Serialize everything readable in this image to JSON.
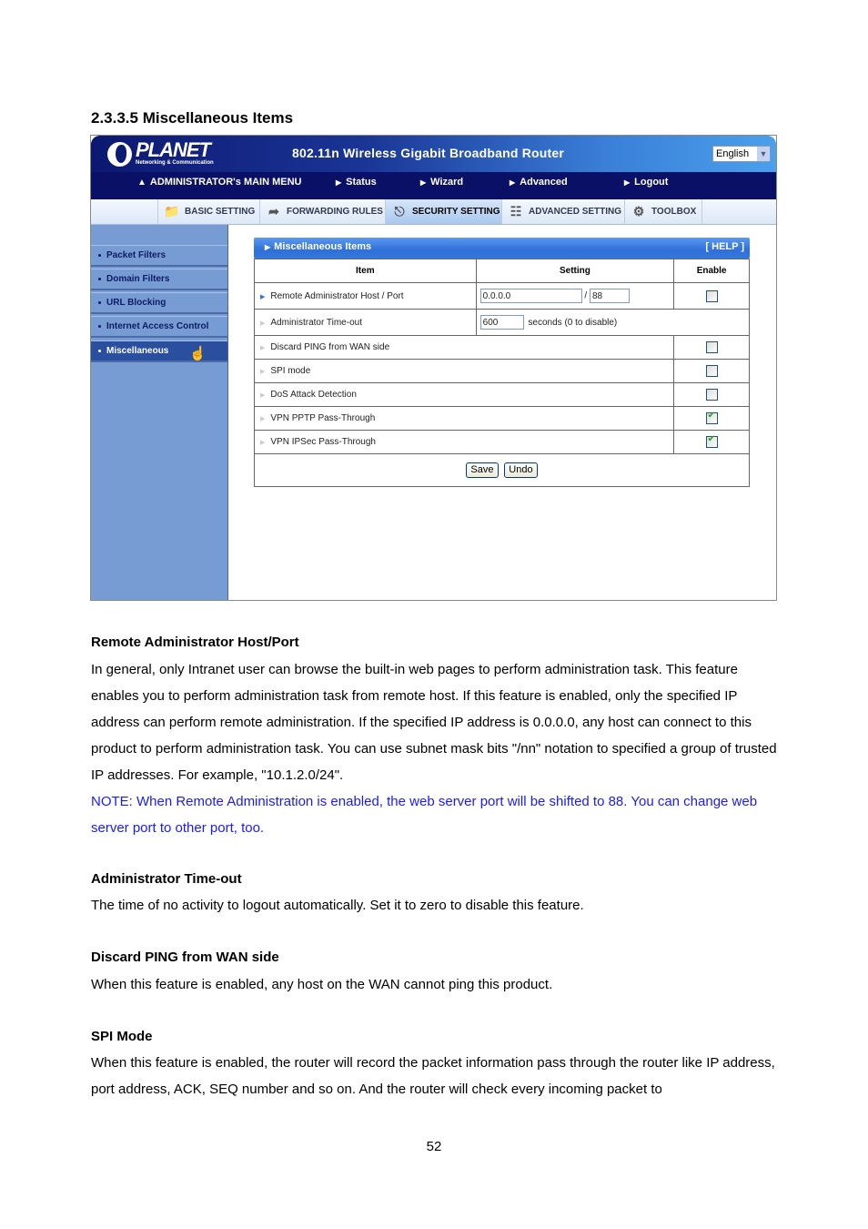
{
  "document": {
    "section_title": "2.3.3.5 Miscellaneous Items",
    "page_number": "52"
  },
  "router_ui": {
    "brand": "PLANET",
    "brand_tagline": "Networking & Communication",
    "product_title": "802.11n Wireless Gigabit Broadband Router",
    "language": {
      "selected": "English"
    },
    "main_menu": [
      {
        "label": "ADMINISTRATOR's MAIN MENU",
        "icon": "person-icon"
      },
      {
        "label": "Status",
        "icon": "triangle-right-icon"
      },
      {
        "label": "Wizard",
        "icon": "triangle-right-icon"
      },
      {
        "label": "Advanced",
        "icon": "triangle-right-icon"
      },
      {
        "label": "Logout",
        "icon": "triangle-right-icon"
      }
    ],
    "tabs": [
      {
        "label": "BASIC SETTING",
        "icon": "documents-icon",
        "active": false
      },
      {
        "label": "FORWARDING RULES",
        "icon": "forwarding-icon",
        "active": false
      },
      {
        "label": "SECURITY SETTING",
        "icon": "router-icon",
        "active": true
      },
      {
        "label": "ADVANCED SETTING",
        "icon": "advanced-icon",
        "active": false
      },
      {
        "label": "TOOLBOX",
        "icon": "toolbox-icon",
        "active": false
      }
    ],
    "sidebar": [
      {
        "label": "Packet Filters",
        "active": false
      },
      {
        "label": "Domain Filters",
        "active": false
      },
      {
        "label": "URL Blocking",
        "active": false
      },
      {
        "label": "Internet Access Control",
        "active": false
      },
      {
        "label": "Miscellaneous",
        "active": true
      }
    ],
    "panel": {
      "title": "Miscellaneous Items",
      "help": "[ HELP ]",
      "columns": [
        "Item",
        "Setting",
        "Enable"
      ],
      "rows": [
        {
          "item": "Remote Administrator Host / Port",
          "host": "0.0.0.0",
          "separator": "/",
          "port": "88",
          "enabled": false
        },
        {
          "item": "Administrator Time-out",
          "timeout": "600",
          "suffix": "seconds (0 to disable)"
        },
        {
          "item": "Discard PING from WAN side",
          "enabled": false
        },
        {
          "item": "SPI mode",
          "enabled": false
        },
        {
          "item": "DoS Attack Detection",
          "enabled": false
        },
        {
          "item": "VPN PPTP Pass-Through",
          "enabled": true
        },
        {
          "item": "VPN IPSec Pass-Through",
          "enabled": true
        }
      ],
      "save_label": "Save",
      "undo_label": "Undo"
    }
  },
  "sections": [
    {
      "heading": "Remote Administrator Host/Port",
      "body": "In general, only Intranet user can browse the built-in web pages to perform administration task. This feature enables you to perform administration task from remote host. If this feature is enabled, only the specified IP address can perform remote administration. If the specified IP address is 0.0.0.0, any host can connect to this product to perform administration task. You can use subnet mask bits \"/nn\" notation to specified a group of trusted IP addresses. For example, \"10.1.2.0/24\".",
      "note": "NOTE: When Remote Administration is enabled, the web server port will be shifted to 88. You can change web server port to other port, too."
    },
    {
      "heading": "Administrator Time-out",
      "body": "The time of no activity to logout automatically. Set it to zero to disable this feature."
    },
    {
      "heading": "Discard PING from WAN side",
      "body": "When this feature is enabled, any host on the WAN cannot ping this product."
    },
    {
      "heading": "SPI Mode",
      "body": "When this feature is enabled, the router will record the packet information pass through the router like IP address, port address, ACK, SEQ number and so on. And the router will check every incoming packet to"
    }
  ]
}
